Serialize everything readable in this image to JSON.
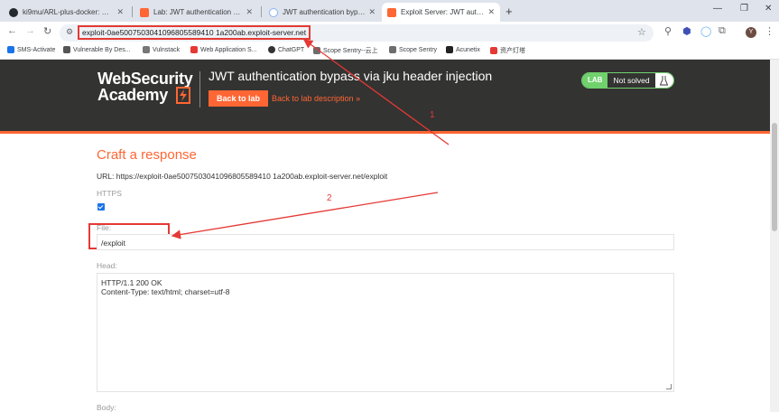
{
  "browser": {
    "tabs": [
      {
        "title": "ki9mu/ARL-plus-docker: 基于",
        "favicon_color": "#24292f"
      },
      {
        "title": "Lab: JWT authentication byp",
        "favicon_color": "#ff6633"
      },
      {
        "title": "JWT authentication bypass v",
        "favicon_color": "#8ab4f8"
      },
      {
        "title": "Exploit Server: JWT authenti",
        "favicon_color": "#ff6633",
        "active": true
      }
    ],
    "url": "exploit-0ae5007503041096805589410 1a200ab.exploit-server.net",
    "bookmarks": [
      {
        "label": "SMS-Activate",
        "color": "#1a73e8"
      },
      {
        "label": "Vulnerable By Des...",
        "color": "#555"
      },
      {
        "label": "Vulnstack",
        "color": "#777"
      },
      {
        "label": "Web Application S...",
        "color": "#e53935"
      },
      {
        "label": "ChatGPT",
        "color": "#333"
      },
      {
        "label": "Scope Sentry--云上",
        "color": "#6d6d6d"
      },
      {
        "label": "Scope Sentry",
        "color": "#6d6d6d"
      },
      {
        "label": "Acunetix",
        "color": "#222"
      },
      {
        "label": "资产灯塔",
        "color": "#e53935"
      }
    ],
    "profile_initial": "Y"
  },
  "header": {
    "logo_line1": "WebSecurity",
    "logo_line2": "Academy",
    "lab_title": "JWT authentication bypass via jku header injection",
    "back_to_lab": "Back to lab",
    "back_to_description": "Back to lab description",
    "back_to_description_chevron": "»",
    "status_badge": "LAB",
    "status_text": "Not solved"
  },
  "form": {
    "title": "Craft a response",
    "url_text": "URL: https://exploit-0ae5007503041096805589410 1a200ab.exploit-server.net/exploit",
    "https_label": "HTTPS",
    "file_label": "File:",
    "file_value": "/exploit",
    "head_label": "Head:",
    "head_value": "HTTP/1.1 200 OK\nContent-Type: text/html; charset=utf-8",
    "body_label": "Body:"
  },
  "annotations": {
    "marker_1": "1",
    "marker_2": "2",
    "color": "#e53935"
  }
}
